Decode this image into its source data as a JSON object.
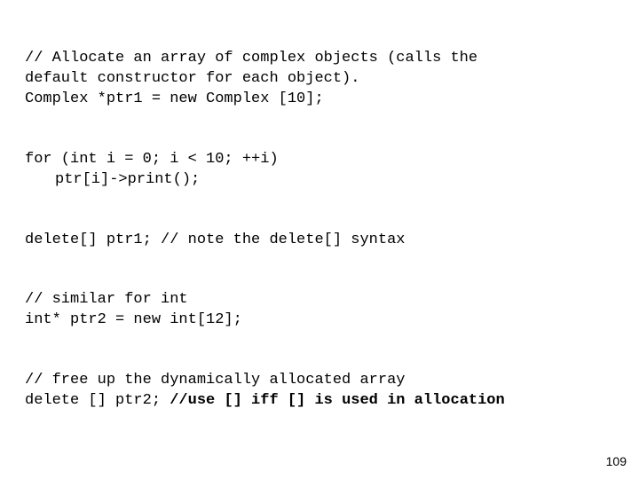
{
  "code": {
    "c1_l1": "// Allocate an array of complex objects (calls the",
    "c1_l2": "default constructor for each object).",
    "c1_l3": "Complex *ptr1 = new Complex [10];",
    "c2_l1": "for (int i = 0; i < 10; ++i)",
    "c2_l2": "ptr[i]->print();",
    "c3_l1": "delete[] ptr1; // note the delete[] syntax",
    "c4_l1": "// similar for int",
    "c4_l2": "int* ptr2 = new int[12];",
    "c5_l1": "// free up the dynamically allocated array",
    "c5_l2a": "delete [] ptr2; ",
    "c5_l2b": "//use [] iff [] is used in allocation"
  },
  "page_number": "109"
}
